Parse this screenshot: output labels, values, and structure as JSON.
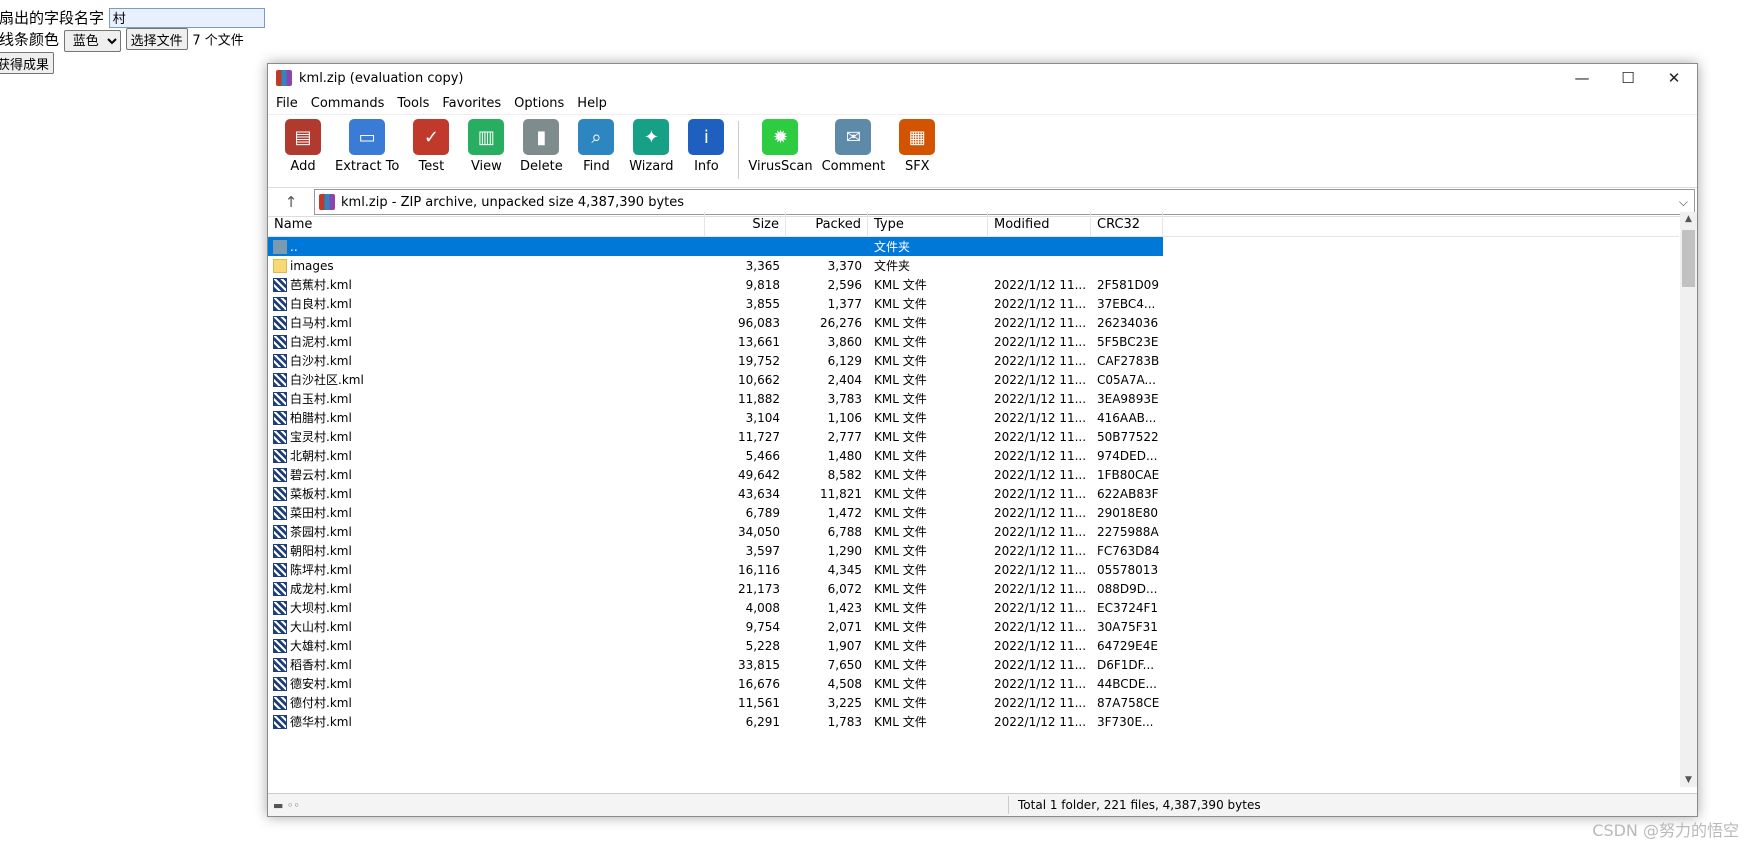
{
  "page_form": {
    "field_label": "要扇出的字段名字",
    "field_value": "村",
    "color_label": "的线条颜色",
    "color_selected": "蓝色",
    "choose_file_label": "选择文件",
    "file_count": "7 个文件",
    "submit_label": "获得成果"
  },
  "window": {
    "title": "kml.zip (evaluation copy)",
    "controls": {
      "minimize": "—",
      "maximize": "☐",
      "close": "✕"
    },
    "menu": [
      "File",
      "Commands",
      "Tools",
      "Favorites",
      "Options",
      "Help"
    ],
    "toolbar": {
      "group1": [
        {
          "label": "Add",
          "icon": "add-icon",
          "color": "#b03a2e"
        },
        {
          "label": "Extract To",
          "icon": "extract-icon",
          "color": "#3a7bd5"
        },
        {
          "label": "Test",
          "icon": "test-icon",
          "color": "#c0392b"
        },
        {
          "label": "View",
          "icon": "view-icon",
          "color": "#27ae60"
        },
        {
          "label": "Delete",
          "icon": "delete-icon",
          "color": "#7f8c8d"
        },
        {
          "label": "Find",
          "icon": "find-icon",
          "color": "#2e86c1"
        },
        {
          "label": "Wizard",
          "icon": "wizard-icon",
          "color": "#16a085"
        },
        {
          "label": "Info",
          "icon": "info-icon",
          "color": "#1f5fbf"
        }
      ],
      "group2": [
        {
          "label": "VirusScan",
          "icon": "virusscan-icon",
          "color": "#2ecc40"
        },
        {
          "label": "Comment",
          "icon": "comment-icon",
          "color": "#5d8aa8"
        },
        {
          "label": "SFX",
          "icon": "sfx-icon",
          "color": "#d35400"
        }
      ]
    },
    "address": "kml.zip - ZIP archive, unpacked size 4,387,390 bytes",
    "columns": {
      "name": "Name",
      "size": "Size",
      "packed": "Packed",
      "type": "Type",
      "modified": "Modified",
      "crc": "CRC32"
    },
    "rows": [
      {
        "name": "..",
        "size": "",
        "packed": "",
        "type": "文件夹",
        "modified": "",
        "crc": "",
        "kind": "parent"
      },
      {
        "name": "images",
        "size": "3,365",
        "packed": "3,370",
        "type": "文件夹",
        "modified": "",
        "crc": "",
        "kind": "folder"
      },
      {
        "name": "芭蕉村.kml",
        "size": "9,818",
        "packed": "2,596",
        "type": "KML 文件",
        "modified": "2022/1/12 11...",
        "crc": "2F581D09",
        "kind": "kml"
      },
      {
        "name": "白良村.kml",
        "size": "3,855",
        "packed": "1,377",
        "type": "KML 文件",
        "modified": "2022/1/12 11...",
        "crc": "37EBC4...",
        "kind": "kml"
      },
      {
        "name": "白马村.kml",
        "size": "96,083",
        "packed": "26,276",
        "type": "KML 文件",
        "modified": "2022/1/12 11...",
        "crc": "26234036",
        "kind": "kml"
      },
      {
        "name": "白泥村.kml",
        "size": "13,661",
        "packed": "3,860",
        "type": "KML 文件",
        "modified": "2022/1/12 11...",
        "crc": "5F5BC23E",
        "kind": "kml"
      },
      {
        "name": "白沙村.kml",
        "size": "19,752",
        "packed": "6,129",
        "type": "KML 文件",
        "modified": "2022/1/12 11...",
        "crc": "CAF2783B",
        "kind": "kml"
      },
      {
        "name": "白沙社区.kml",
        "size": "10,662",
        "packed": "2,404",
        "type": "KML 文件",
        "modified": "2022/1/12 11...",
        "crc": "C05A7A...",
        "kind": "kml"
      },
      {
        "name": "白玉村.kml",
        "size": "11,882",
        "packed": "3,783",
        "type": "KML 文件",
        "modified": "2022/1/12 11...",
        "crc": "3EA9893E",
        "kind": "kml"
      },
      {
        "name": "柏腊村.kml",
        "size": "3,104",
        "packed": "1,106",
        "type": "KML 文件",
        "modified": "2022/1/12 11...",
        "crc": "416AAB...",
        "kind": "kml"
      },
      {
        "name": "宝灵村.kml",
        "size": "11,727",
        "packed": "2,777",
        "type": "KML 文件",
        "modified": "2022/1/12 11...",
        "crc": "50B77522",
        "kind": "kml"
      },
      {
        "name": "北朝村.kml",
        "size": "5,466",
        "packed": "1,480",
        "type": "KML 文件",
        "modified": "2022/1/12 11...",
        "crc": "974DED...",
        "kind": "kml"
      },
      {
        "name": "碧云村.kml",
        "size": "49,642",
        "packed": "8,582",
        "type": "KML 文件",
        "modified": "2022/1/12 11...",
        "crc": "1FB80CAE",
        "kind": "kml"
      },
      {
        "name": "菜板村.kml",
        "size": "43,634",
        "packed": "11,821",
        "type": "KML 文件",
        "modified": "2022/1/12 11...",
        "crc": "622AB83F",
        "kind": "kml"
      },
      {
        "name": "菜田村.kml",
        "size": "6,789",
        "packed": "1,472",
        "type": "KML 文件",
        "modified": "2022/1/12 11...",
        "crc": "29018E80",
        "kind": "kml"
      },
      {
        "name": "茶园村.kml",
        "size": "34,050",
        "packed": "6,788",
        "type": "KML 文件",
        "modified": "2022/1/12 11...",
        "crc": "2275988A",
        "kind": "kml"
      },
      {
        "name": "朝阳村.kml",
        "size": "3,597",
        "packed": "1,290",
        "type": "KML 文件",
        "modified": "2022/1/12 11...",
        "crc": "FC763D84",
        "kind": "kml"
      },
      {
        "name": "陈坪村.kml",
        "size": "16,116",
        "packed": "4,345",
        "type": "KML 文件",
        "modified": "2022/1/12 11...",
        "crc": "05578013",
        "kind": "kml"
      },
      {
        "name": "成龙村.kml",
        "size": "21,173",
        "packed": "6,072",
        "type": "KML 文件",
        "modified": "2022/1/12 11...",
        "crc": "088D9D...",
        "kind": "kml"
      },
      {
        "name": "大坝村.kml",
        "size": "4,008",
        "packed": "1,423",
        "type": "KML 文件",
        "modified": "2022/1/12 11...",
        "crc": "EC3724F1",
        "kind": "kml"
      },
      {
        "name": "大山村.kml",
        "size": "9,754",
        "packed": "2,071",
        "type": "KML 文件",
        "modified": "2022/1/12 11...",
        "crc": "30A75F31",
        "kind": "kml"
      },
      {
        "name": "大雄村.kml",
        "size": "5,228",
        "packed": "1,907",
        "type": "KML 文件",
        "modified": "2022/1/12 11...",
        "crc": "64729E4E",
        "kind": "kml"
      },
      {
        "name": "稻香村.kml",
        "size": "33,815",
        "packed": "7,650",
        "type": "KML 文件",
        "modified": "2022/1/12 11...",
        "crc": "D6F1DF...",
        "kind": "kml"
      },
      {
        "name": "德安村.kml",
        "size": "16,676",
        "packed": "4,508",
        "type": "KML 文件",
        "modified": "2022/1/12 11...",
        "crc": "44BCDE...",
        "kind": "kml"
      },
      {
        "name": "德付村.kml",
        "size": "11,561",
        "packed": "3,225",
        "type": "KML 文件",
        "modified": "2022/1/12 11...",
        "crc": "87A758CE",
        "kind": "kml"
      },
      {
        "name": "德华村.kml",
        "size": "6,291",
        "packed": "1,783",
        "type": "KML 文件",
        "modified": "2022/1/12 11...",
        "crc": "3F730E...",
        "kind": "kml"
      }
    ],
    "status": "Total 1 folder, 221 files, 4,387,390 bytes",
    "status_icons": "▬ ◦◦"
  },
  "watermark": "CSDN @努力的悟空",
  "colors": {
    "selection": "#0078d7",
    "folder": "#f8d775"
  }
}
